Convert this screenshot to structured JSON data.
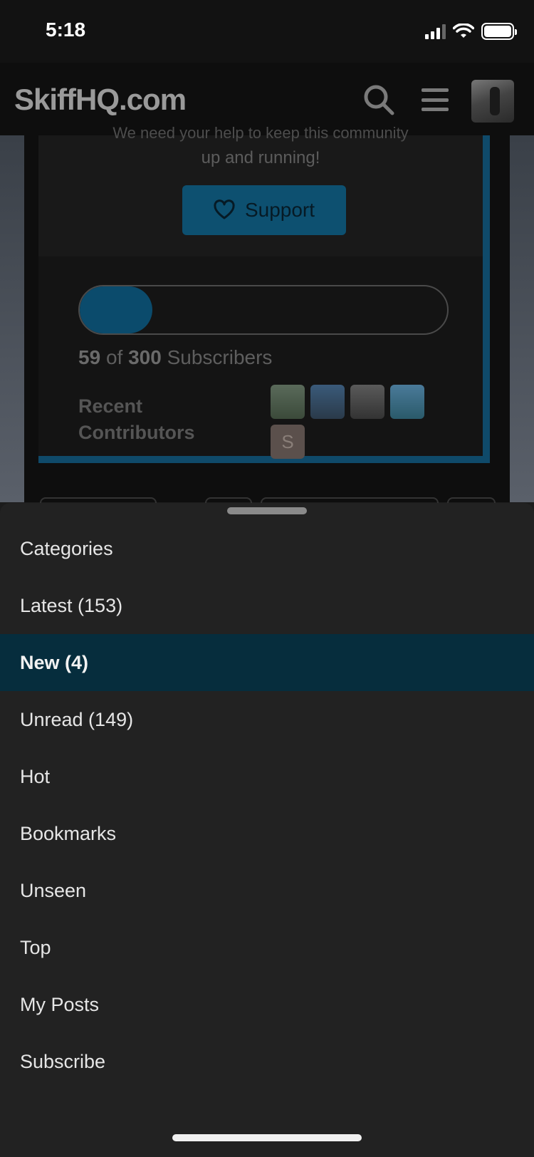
{
  "status_bar": {
    "time": "5:18"
  },
  "header": {
    "logo": "SkiffHQ.com"
  },
  "support_card": {
    "partial_text": "We need your help to keep this community",
    "running_text": "up and running!",
    "support_label": "Support",
    "progress": {
      "current": 59,
      "total": 300,
      "fraction": 0.197
    },
    "subs_current": "59",
    "subs_of": "of",
    "subs_total": "300",
    "subs_label": "Subscribers",
    "contributors_label": "Recent Contributors",
    "contributor_initial": "S"
  },
  "menu": {
    "items": [
      {
        "label": "Categories"
      },
      {
        "label": "Latest (153)"
      },
      {
        "label": "New (4)"
      },
      {
        "label": "Unread (149)"
      },
      {
        "label": "Hot"
      },
      {
        "label": "Bookmarks"
      },
      {
        "label": "Unseen"
      },
      {
        "label": "Top"
      },
      {
        "label": "My Posts"
      },
      {
        "label": "Subscribe"
      }
    ],
    "active_index": 2
  },
  "colors": {
    "accent": "#0d5070",
    "active_row": "#062d3d",
    "sheet_bg": "#222222"
  }
}
